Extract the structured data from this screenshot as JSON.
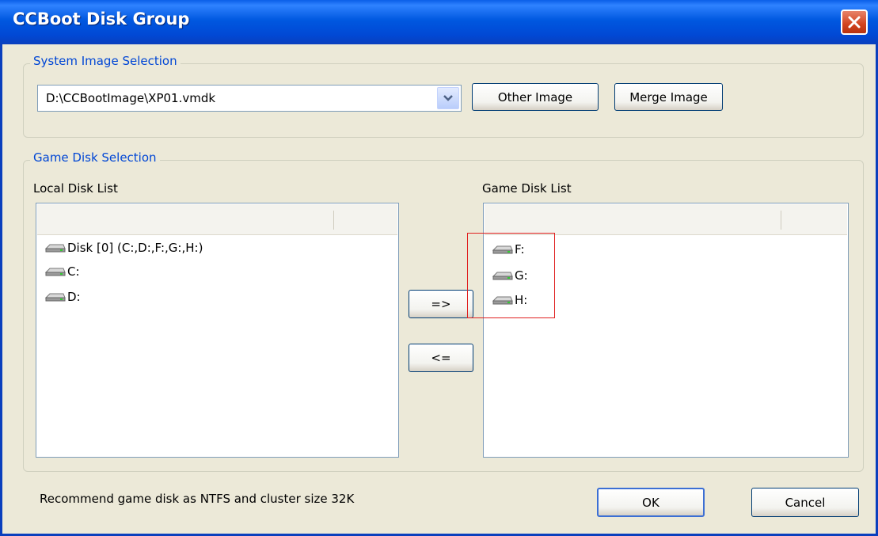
{
  "window": {
    "title": "CCBoot Disk Group"
  },
  "system_image": {
    "group_label": "System Image Selection",
    "selected_image": "D:\\CCBootImage\\XP01.vmdk",
    "other_image_label": "Other Image",
    "merge_image_label": "Merge Image"
  },
  "game_disk": {
    "group_label": "Game Disk Selection",
    "local_list_label": "Local Disk List",
    "game_list_label": "Game Disk List",
    "local_items": [
      "Disk [0] (C:,D:,F:,G:,H:)",
      "C:",
      "D:"
    ],
    "game_items": [
      "F:",
      "G:",
      "H:"
    ],
    "add_label": "=>",
    "remove_label": "<="
  },
  "footer": {
    "note": "Recommend game disk as NTFS and cluster size 32K",
    "ok_label": "OK",
    "cancel_label": "Cancel"
  },
  "colors": {
    "title_bar": "#0058e0",
    "highlight_box": "#e02020",
    "group_label": "#0046d5"
  }
}
